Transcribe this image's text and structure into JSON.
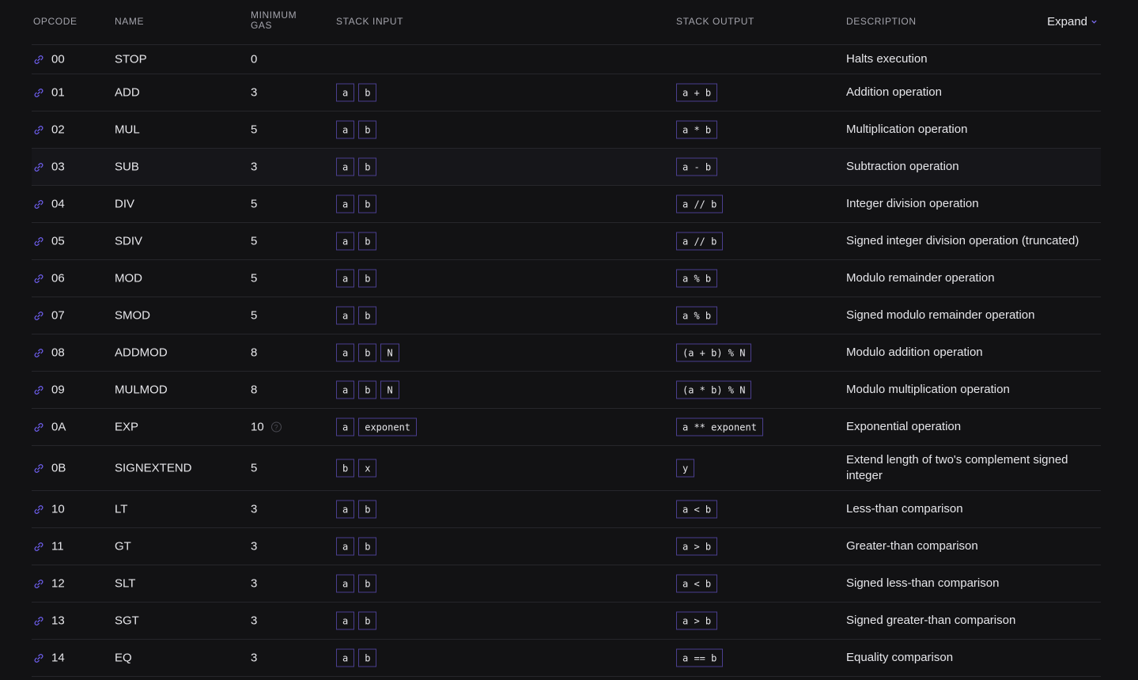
{
  "headers": {
    "opcode": "OPCODE",
    "name": "NAME",
    "gas_line1": "MINIMUM",
    "gas_line2": "GAS",
    "stack_input": "STACK INPUT",
    "stack_output": "STACK OUTPUT",
    "description": "DESCRIPTION",
    "expand": "Expand"
  },
  "rows": [
    {
      "op": "00",
      "name": "STOP",
      "gas": "0",
      "inputs": [],
      "output": "",
      "desc": "Halts execution"
    },
    {
      "op": "01",
      "name": "ADD",
      "gas": "3",
      "inputs": [
        "a",
        "b"
      ],
      "output": "a + b",
      "desc": "Addition operation"
    },
    {
      "op": "02",
      "name": "MUL",
      "gas": "5",
      "inputs": [
        "a",
        "b"
      ],
      "output": "a * b",
      "desc": "Multiplication operation"
    },
    {
      "op": "03",
      "name": "SUB",
      "gas": "3",
      "inputs": [
        "a",
        "b"
      ],
      "output": "a - b",
      "desc": "Subtraction operation"
    },
    {
      "op": "04",
      "name": "DIV",
      "gas": "5",
      "inputs": [
        "a",
        "b"
      ],
      "output": "a // b",
      "desc": "Integer division operation"
    },
    {
      "op": "05",
      "name": "SDIV",
      "gas": "5",
      "inputs": [
        "a",
        "b"
      ],
      "output": "a // b",
      "desc": "Signed integer division operation (truncated)"
    },
    {
      "op": "06",
      "name": "MOD",
      "gas": "5",
      "inputs": [
        "a",
        "b"
      ],
      "output": "a % b",
      "desc": "Modulo remainder operation"
    },
    {
      "op": "07",
      "name": "SMOD",
      "gas": "5",
      "inputs": [
        "a",
        "b"
      ],
      "output": "a % b",
      "desc": "Signed modulo remainder operation"
    },
    {
      "op": "08",
      "name": "ADDMOD",
      "gas": "8",
      "inputs": [
        "a",
        "b",
        "N"
      ],
      "output": "(a + b) % N",
      "desc": "Modulo addition operation"
    },
    {
      "op": "09",
      "name": "MULMOD",
      "gas": "8",
      "inputs": [
        "a",
        "b",
        "N"
      ],
      "output": "(a * b) % N",
      "desc": "Modulo multiplication operation"
    },
    {
      "op": "0A",
      "name": "EXP",
      "gas": "10",
      "help": "?",
      "inputs": [
        "a",
        "exponent"
      ],
      "output": "a ** exponent",
      "desc": "Exponential operation"
    },
    {
      "op": "0B",
      "name": "SIGNEXTEND",
      "gas": "5",
      "inputs": [
        "b",
        "x"
      ],
      "output": "y",
      "desc": "Extend length of two's complement signed integer"
    },
    {
      "op": "10",
      "name": "LT",
      "gas": "3",
      "inputs": [
        "a",
        "b"
      ],
      "output": "a < b",
      "desc": "Less-than comparison"
    },
    {
      "op": "11",
      "name": "GT",
      "gas": "3",
      "inputs": [
        "a",
        "b"
      ],
      "output": "a > b",
      "desc": "Greater-than comparison"
    },
    {
      "op": "12",
      "name": "SLT",
      "gas": "3",
      "inputs": [
        "a",
        "b"
      ],
      "output": "a < b",
      "desc": "Signed less-than comparison"
    },
    {
      "op": "13",
      "name": "SGT",
      "gas": "3",
      "inputs": [
        "a",
        "b"
      ],
      "output": "a > b",
      "desc": "Signed greater-than comparison"
    },
    {
      "op": "14",
      "name": "EQ",
      "gas": "3",
      "inputs": [
        "a",
        "b"
      ],
      "output": "a == b",
      "desc": "Equality comparison"
    }
  ],
  "colors": {
    "background": "#121214",
    "accent": "#6b5ce7",
    "box_border": "#4b3f8f",
    "divider": "#26262b"
  },
  "icons": {
    "row_link": "link-icon",
    "expand": "chevron-down-icon",
    "gas_help": "help-icon"
  }
}
